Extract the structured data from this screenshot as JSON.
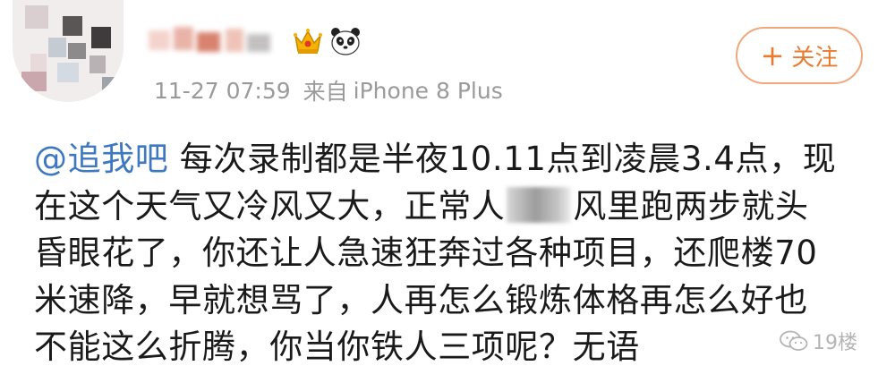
{
  "post": {
    "user": {
      "badges": [
        "crown-icon",
        "panda-icon"
      ]
    },
    "meta": {
      "time": "11-27 07:59",
      "source_prefix": "来自",
      "device": "iPhone 8 Plus"
    },
    "follow_button": {
      "icon": "+",
      "label": "关注"
    },
    "content": {
      "mention": "@追我吧",
      "line1": " 每次录制都是半夜10.11点到凌晨3.4点，现",
      "line2_before": "在这个天气又冷风又大，正常人",
      "line2_after": "风里跑两步就头",
      "line3": "昏眼花了，你还让人急速狂奔过各种项目，还爬楼70",
      "line4": "米速降，早就想骂了，人再怎么锻炼体格再怎么好也",
      "line5": "不能这么折腾，你当你铁人三项呢？无语"
    }
  },
  "watermark": {
    "text": "19楼"
  },
  "colors": {
    "mention": "#3e78c0",
    "follow_accent": "#e97a2e",
    "meta_gray": "#9a9a9a"
  }
}
